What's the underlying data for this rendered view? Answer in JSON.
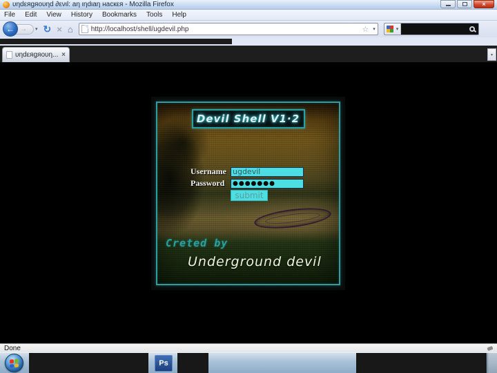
{
  "window": {
    "title": "υηdεяgяoυηd ∂ενιl: aη ιηdιaη нaскεя - Mozilla Firefox"
  },
  "menu": {
    "items": [
      "File",
      "Edit",
      "View",
      "History",
      "Bookmarks",
      "Tools",
      "Help"
    ]
  },
  "nav": {
    "url": "http://localhost/shell/ugdevil.php"
  },
  "tabs": {
    "active_label": "υηdεяgяoυη..."
  },
  "icons": {
    "back_arrow": "←",
    "forward_arrow": "→",
    "dropdown_caret": "▾",
    "reload": "↻",
    "stop": "×",
    "home": "⌂",
    "bookmark_star": "☆",
    "window_close": "×",
    "tab_close": "×",
    "tab_list_caret": "▾"
  },
  "page": {
    "shell_title": "Devil Shell V1·2",
    "form": {
      "username_label": "Username",
      "username_value": "ugdevil",
      "password_label": "Password",
      "password_value": "●●●●●●●",
      "submit_label": "submit"
    },
    "credit_prefix": "Creted by",
    "credit_name": "Underground devil"
  },
  "status": {
    "text": "Done"
  },
  "taskbar": {
    "photoshop_label": "Ps"
  },
  "colors": {
    "panel_accent": "#2d9fa0",
    "input_cyan": "#4bdfe3",
    "page_background": "#000000",
    "taskbar_blue": "#aac3d8",
    "close_button_red": "#d0452c"
  }
}
